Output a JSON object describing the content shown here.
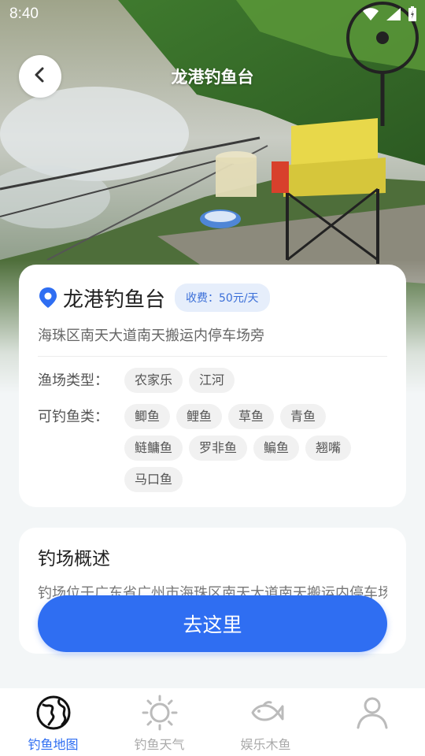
{
  "status_bar": {
    "time": "8:40",
    "icons": [
      "wifi-icon",
      "signal-icon",
      "battery-icon"
    ]
  },
  "header": {
    "title": "龙港钓鱼台",
    "back_icon": "chevron-left-icon"
  },
  "spot": {
    "name": "龙港钓鱼台",
    "pin_icon": "location-pin-icon",
    "fee": "收费：50元/天",
    "address": "海珠区南天大道南天搬运内停车场旁",
    "attributes": [
      {
        "label": "渔场类型：",
        "tags": [
          "农家乐",
          "江河"
        ]
      },
      {
        "label": "可钓鱼类：",
        "tags": [
          "鲫鱼",
          "鲤鱼",
          "草鱼",
          "青鱼",
          "鲢鳙鱼",
          "罗非鱼",
          "鳊鱼",
          "翘嘴",
          "马口鱼"
        ]
      }
    ]
  },
  "overview": {
    "title": "钓场概述",
    "text": "钓场位于广东省广州市海珠区南天大道南天搬运内停车场旁"
  },
  "go_button": {
    "label": "去这里"
  },
  "tab_bar": {
    "items": [
      {
        "label": "钓鱼地图",
        "icon": "globe-icon",
        "active": true
      },
      {
        "label": "钓鱼天气",
        "icon": "sun-icon",
        "active": false
      },
      {
        "label": "娱乐木鱼",
        "icon": "fish-icon",
        "active": false
      },
      {
        "label": "",
        "icon": "user-icon",
        "active": false
      }
    ]
  },
  "colors": {
    "accent": "#2f6ef2",
    "badge_bg": "#e6eefb",
    "badge_text": "#3b6fd8"
  }
}
